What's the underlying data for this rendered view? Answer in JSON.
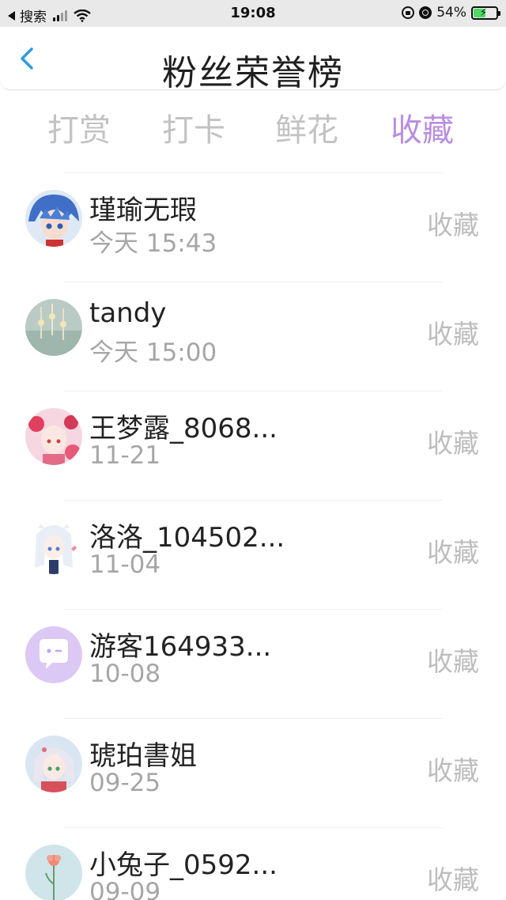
{
  "status_bar": {
    "carrier": "搜索",
    "time": "19:08",
    "battery_text": "54%",
    "battery_level": 0.54
  },
  "header": {
    "back_icon": "chevron-left-icon",
    "title": "粉丝荣誉榜"
  },
  "tabs": [
    {
      "label": "打赏",
      "active": false
    },
    {
      "label": "打卡",
      "active": false
    },
    {
      "label": "鲜花",
      "active": false
    },
    {
      "label": "收藏",
      "active": true
    }
  ],
  "colors": {
    "accent": "#b98ee0",
    "back_chevron": "#2d9cdb",
    "muted_text": "#a6a6a6"
  },
  "fans": [
    {
      "name": "瑾瑜无瑕",
      "time": "今天 15:43",
      "action": "收藏",
      "avatar": "anime-boy-avatar"
    },
    {
      "name": "tandy",
      "time": "今天 15:00",
      "action": "收藏",
      "avatar": "scenery-avatar"
    },
    {
      "name": "王梦露_8068...",
      "time": "11-21",
      "action": "收藏",
      "avatar": "anime-girl-pink-avatar"
    },
    {
      "name": "洛洛_104502...",
      "time": "11-04",
      "action": "收藏",
      "avatar": "anime-girl-white-avatar"
    },
    {
      "name": "游客164933...",
      "time": "10-08",
      "action": "收藏",
      "avatar": "default-chat-avatar"
    },
    {
      "name": "琥珀書姐",
      "time": "09-25",
      "action": "收藏",
      "avatar": "anime-girl-silver-avatar"
    },
    {
      "name": "小兔子_0592...",
      "time": "09-09",
      "action": "收藏",
      "avatar": "flower-avatar"
    }
  ]
}
